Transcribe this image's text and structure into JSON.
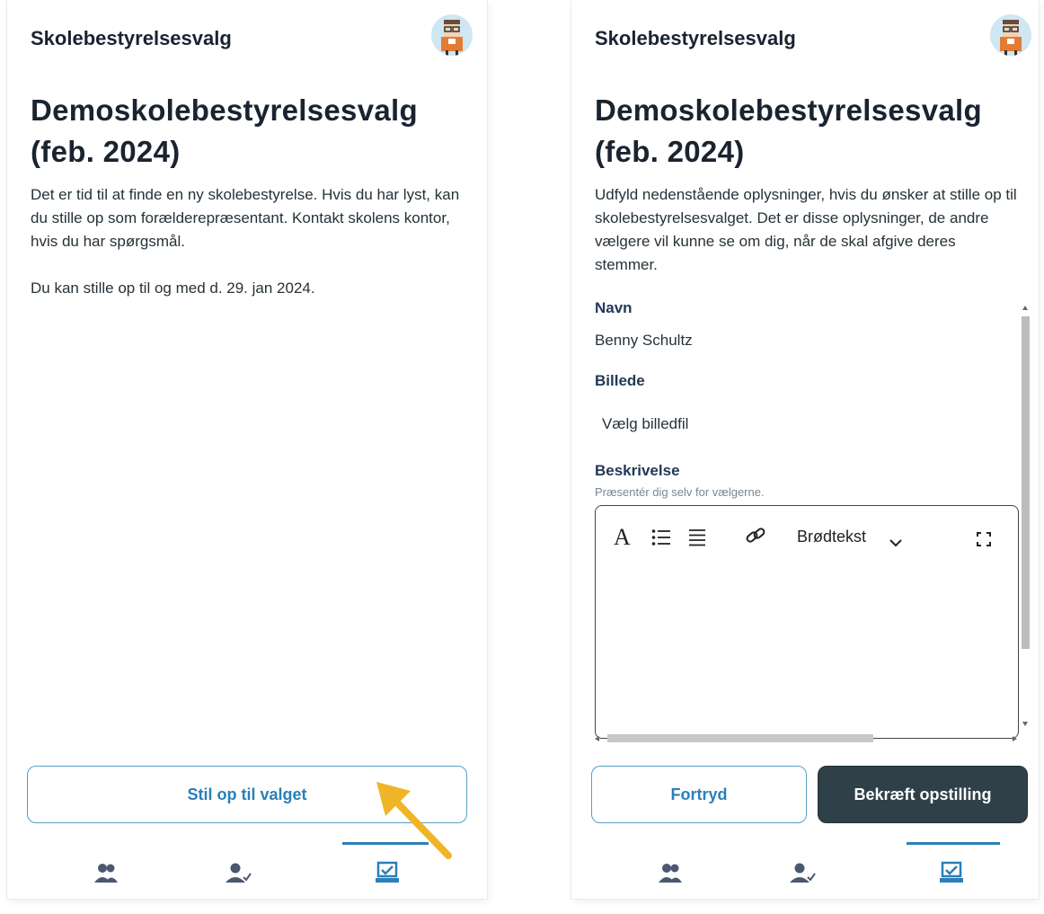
{
  "left_screen": {
    "app_title": "Skolebestyrelsesvalg",
    "heading": "Demoskolebestyrelsesvalg (feb. 2024)",
    "paragraph1": "Det er tid til at finde en ny skolebestyrelse. Hvis du har lyst, kan du stille op som forælderepræsentant. Kontakt skolens kontor, hvis du har spørgsmål.",
    "paragraph2": "Du kan stille op til og med d. 29. jan 2024.",
    "primary_button": "Stil op til valget"
  },
  "right_screen": {
    "app_title": "Skolebestyrelsesvalg",
    "heading": "Demoskolebestyrelsesvalg (feb. 2024)",
    "intro": "Udfyld nedenstående oplysninger, hvis du ønsker at stille op til skolebestyrelsesvalget. Det er disse oplysninger, de andre vælgere vil kunne se om dig, når de skal afgive deres stemmer.",
    "name_label": "Navn",
    "name_value": "Benny Schultz",
    "image_label": "Billede",
    "image_button": "Vælg billedfil",
    "description_label": "Beskrivelse",
    "description_hint": "Præsentér dig selv for vælgerne.",
    "editor": {
      "font_icon": "A",
      "format_select": "Brødtekst"
    },
    "cancel_button": "Fortryd",
    "confirm_button": "Bekræft opstilling"
  },
  "bottom_nav": {
    "items": [
      {
        "icon": "people-icon",
        "active": false
      },
      {
        "icon": "person-check-icon",
        "active": false
      },
      {
        "icon": "ballot-check-icon",
        "active": true
      }
    ]
  },
  "colors": {
    "accent": "#2a7fb8",
    "dark_button": "#2f4048",
    "arrow": "#f0b428",
    "nav_icon": "#4a5870"
  }
}
